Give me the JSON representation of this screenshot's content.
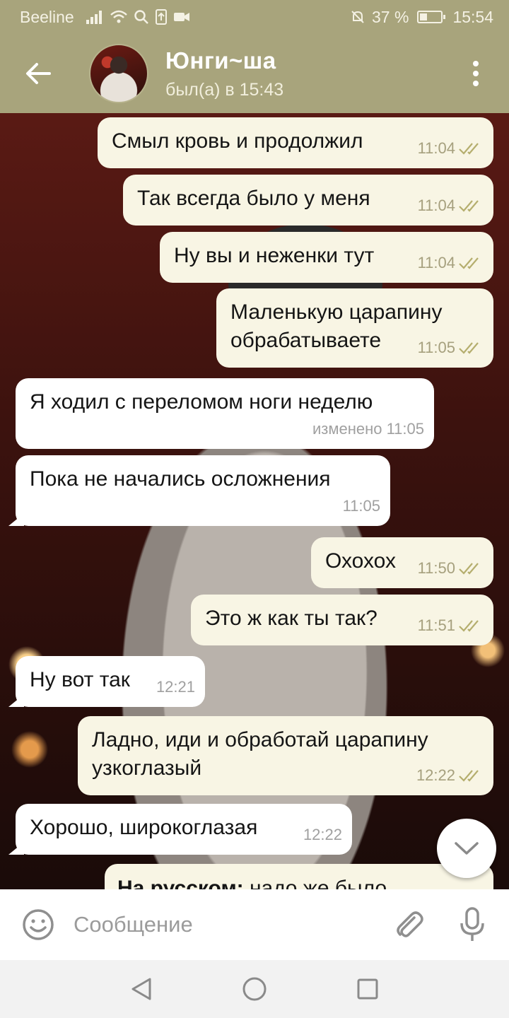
{
  "status_bar": {
    "carrier": "Beeline",
    "battery_percent": "37 %",
    "time": "15:54"
  },
  "header": {
    "contact_name": "Юнги~ша",
    "contact_status": "был(а) в 15:43"
  },
  "messages": [
    {
      "direction": "out",
      "text": "Смыл кровь и продолжил",
      "time": "11:04",
      "read": true
    },
    {
      "direction": "out",
      "text": "Так всегда было у меня",
      "time": "11:04",
      "read": true
    },
    {
      "direction": "out",
      "text": "Ну вы и неженки тут",
      "time": "11:04",
      "read": true
    },
    {
      "direction": "out",
      "text": "Маленькую царапину обрабатываете",
      "time": "11:05",
      "read": true
    },
    {
      "direction": "in",
      "text": "Я ходил с переломом ноги неделю",
      "time": "изменено 11:05"
    },
    {
      "direction": "in",
      "text": "Пока не начались осложнения",
      "time": "11:05"
    },
    {
      "direction": "out",
      "text": "Охохох",
      "time": "11:50",
      "read": true
    },
    {
      "direction": "out",
      "text": "Это ж как ты так?",
      "time": "11:51",
      "read": true
    },
    {
      "direction": "in",
      "text": "Ну вот так",
      "time": "12:21"
    },
    {
      "direction": "out",
      "text": "Ладно, иди и обработай царапину узкоглазый",
      "time": "12:22",
      "read": true
    },
    {
      "direction": "in",
      "text": "Хорошо, широкоглазая",
      "time": "12:22"
    }
  ],
  "partial_message": {
    "bold": "На русском:",
    "text": " надо же было"
  },
  "input": {
    "placeholder": "Сообщение"
  },
  "colors": {
    "header": "#a8a47c",
    "bubble_out": "#f8f5e4",
    "bubble_in": "#ffffff",
    "check": "#b5ae6e"
  }
}
